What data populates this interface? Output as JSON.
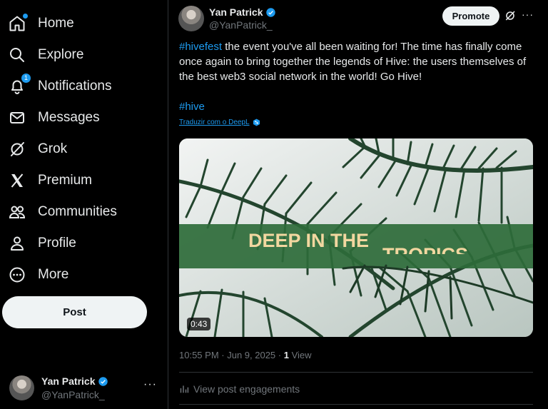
{
  "nav": {
    "items": [
      {
        "label": "Home",
        "icon": "home-icon"
      },
      {
        "label": "Explore",
        "icon": "search-icon"
      },
      {
        "label": "Notifications",
        "icon": "bell-icon",
        "badge": "1"
      },
      {
        "label": "Messages",
        "icon": "envelope-icon"
      },
      {
        "label": "Grok",
        "icon": "grok-icon"
      },
      {
        "label": "Premium",
        "icon": "x-logo-icon"
      },
      {
        "label": "Communities",
        "icon": "people-icon"
      },
      {
        "label": "Profile",
        "icon": "person-icon"
      },
      {
        "label": "More",
        "icon": "more-circle-icon"
      }
    ],
    "post_label": "Post"
  },
  "account": {
    "name": "Yan Patrick",
    "handle": "@YanPatrick_",
    "more": "···"
  },
  "post": {
    "author_name": "Yan Patrick",
    "author_handle": "@YanPatrick_",
    "promote_label": "Promote",
    "more": "···",
    "tag1": "#hivefest",
    "text": " the event you've all been waiting for! The time has finally come once again to bring together the legends of Hive: the users themselves of the best web3 social network in the world! Go Hive!",
    "tag2": "#hive",
    "translate": "Traduzir com o DeepL",
    "media": {
      "overlay_title": "DEEP IN THE",
      "overlay_partial": "TROPICS",
      "duration": "0:43"
    },
    "time": "10:55 PM",
    "sep": " · ",
    "date": "Jun 9, 2025",
    "views_count": "1",
    "views_label": " View",
    "engagements": "View post engagements"
  },
  "colors": {
    "accent": "#1d9bf0",
    "banner": "#2e6b3a",
    "banner_text": "#f2d7a0"
  }
}
